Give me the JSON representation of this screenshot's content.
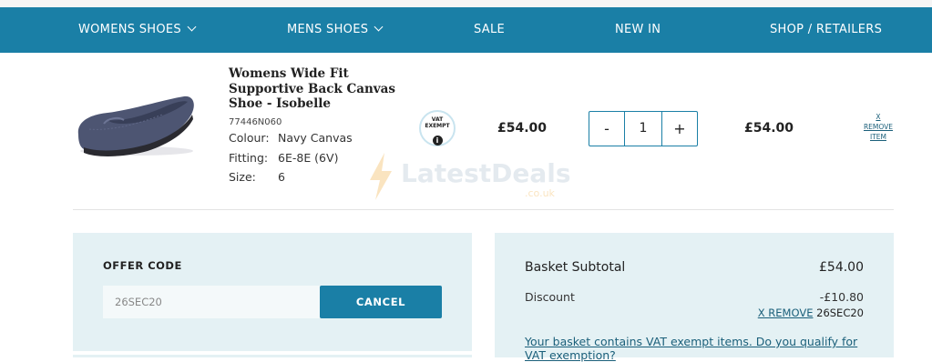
{
  "nav": {
    "items": [
      {
        "label": "WOMENS SHOES",
        "dropdown": true
      },
      {
        "label": "MENS SHOES",
        "dropdown": true
      },
      {
        "label": "SALE",
        "dropdown": false
      },
      {
        "label": "NEW IN",
        "dropdown": false
      },
      {
        "label": "SHOP / RETAILERS",
        "dropdown": false
      }
    ]
  },
  "product": {
    "title": "Womens Wide Fit Supportive Back Canvas Shoe - Isobelle",
    "sku": "77446N060",
    "colour_label": "Colour:",
    "colour_value": "Navy Canvas",
    "fitting_label": "Fitting:",
    "fitting_value": "6E-8E (6V)",
    "size_label": "Size:",
    "size_value": "6",
    "vat_badge": "VAT EXEMPT",
    "unit_price": "£54.00",
    "quantity": "1",
    "qty_minus": "-",
    "qty_plus": "+",
    "line_total": "£54.00",
    "remove_x": "X",
    "remove_label": "REMOVE ITEM"
  },
  "watermark": {
    "text": "LatestDeals",
    "sub": ".co.uk"
  },
  "offer": {
    "title": "OFFER CODE",
    "code_value": "26SEC20",
    "button_label": "CANCEL"
  },
  "summary": {
    "subtotal_label": "Basket Subtotal",
    "subtotal_value": "£54.00",
    "discount_label": "Discount",
    "discount_value": "-£10.80",
    "remove_discount_label": "X REMOVE",
    "discount_code": "26SEC20",
    "vat_question": "Your basket contains VAT exempt items. Do you qualify for VAT exemption?"
  },
  "colors": {
    "brand": "#1a7fa6",
    "panel_bg": "#e4f1f4",
    "link": "#1a5f7a"
  }
}
